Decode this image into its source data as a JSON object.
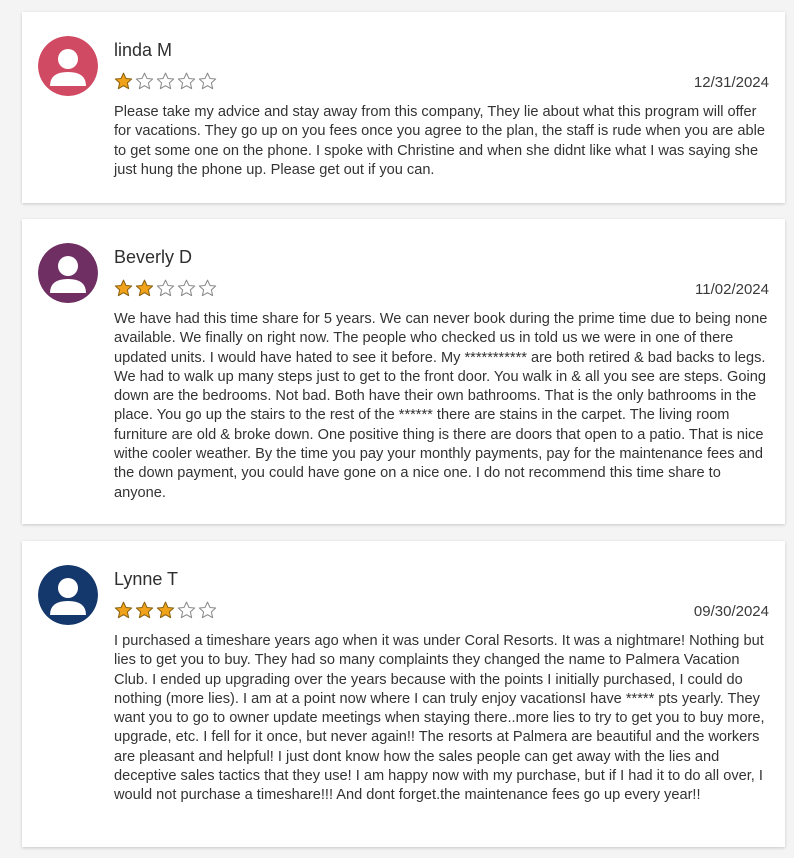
{
  "colors": {
    "star_filled": "#f0a21b",
    "star_empty_outline": "#8a8a8a"
  },
  "reviews": [
    {
      "name": "linda M",
      "rating": 1,
      "max_rating": 5,
      "date": "12/31/2024",
      "avatar_color": "#d14a63",
      "text": "Please take my advice and stay away from this company, They lie about what this program will offer for vacations. They go up on you fees once you agree to the plan, the staff is rude when you are able to get some one on the phone. I spoke with Christine and when she didnt like what I was saying she just hung the phone up. Please get out if you can."
    },
    {
      "name": "Beverly D",
      "rating": 2,
      "max_rating": 5,
      "date": "11/02/2024",
      "avatar_color": "#6f2f63",
      "text": "We have had this time share for 5 years. We can never book during the prime time due to being none available. We finally on right now. The people who checked us in told us we were in one of there updated units. I would have hated to see it before. My *********** are both retired & bad backs to legs. We had to walk up many steps just to get to the front door. You walk in & all you see are steps. Going down are the bedrooms. Not bad. Both have their own bathrooms. That is the only bathrooms in the place. You go up the stairs to the rest of the ****** there are stains in the carpet. The living room furniture are old & broke down. One positive thing is there are doors that open to a patio. That is nice withe cooler weather. By the time you pay your monthly payments, pay for the maintenance fees and the down payment, you could have gone on a nice one. I do not recommend this time share to anyone."
    },
    {
      "name": "Lynne T",
      "rating": 3,
      "max_rating": 5,
      "date": "09/30/2024",
      "avatar_color": "#14386b",
      "text": "I purchased a timeshare years ago when it was under Coral Resorts. It was a nightmare! Nothing but lies to get you to buy. They had so many complaints they changed the name to Palmera Vacation Club. I ended up upgrading over the years because with the points I initially purchased, I could do nothing (more lies). I am at a point now where I can truly enjoy vacationsI have ***** pts yearly. They want you to go to owner update meetings when staying there..more lies to try to get you to buy more, upgrade, etc. I fell for it once, but never again!! The resorts at Palmera are beautiful and the workers are pleasant and helpful! I just dont know how the sales people can get away with the lies and deceptive sales tactics that they use! I am happy now with my purchase, but if I had it to do all over, I would not purchase a timeshare!!! And dont forget.the maintenance fees go up every year!!"
    }
  ]
}
